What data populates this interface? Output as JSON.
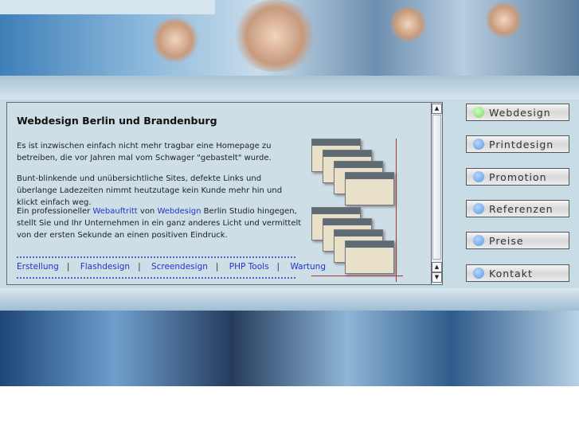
{
  "main": {
    "title": "Webdesign Berlin und Brandenburg",
    "p1": "Es ist inzwischen einfach nicht mehr tragbar eine Homepage zu betreiben, die vor Jahren mal vom Schwager \"gebastelt\" wurde.",
    "p2": "Bunt-blinkende und unübersichtliche Sites, defekte Links und überlange Ladezeiten nimmt heutzutage kein Kunde mehr hin und klickt einfach weg.",
    "p3_a": "Ein professioneller ",
    "p3_link1": "Webauftritt",
    "p3_b": " von ",
    "p3_link2": "Webdesign",
    "p3_c": " Berlin Studio hingegen, stellt Sie und Ihr Unternehmen in ein ganz anderes Licht und vermittelt von der ersten Sekunde an einen positiven Eindruck.",
    "links": [
      "Erstellung",
      "Flashdesign",
      "Screendesign",
      "PHP Tools",
      "Wartung"
    ],
    "separator": "|"
  },
  "nav": {
    "items": [
      {
        "label": "Webdesign",
        "active": true
      },
      {
        "label": "Printdesign",
        "active": false
      },
      {
        "label": "Promotion",
        "active": false
      },
      {
        "label": "Referenzen",
        "active": false
      },
      {
        "label": "Preise",
        "active": false
      },
      {
        "label": "Kontakt",
        "active": false
      }
    ],
    "active_color": "#78d860",
    "inactive_color": "#5f98e0"
  }
}
